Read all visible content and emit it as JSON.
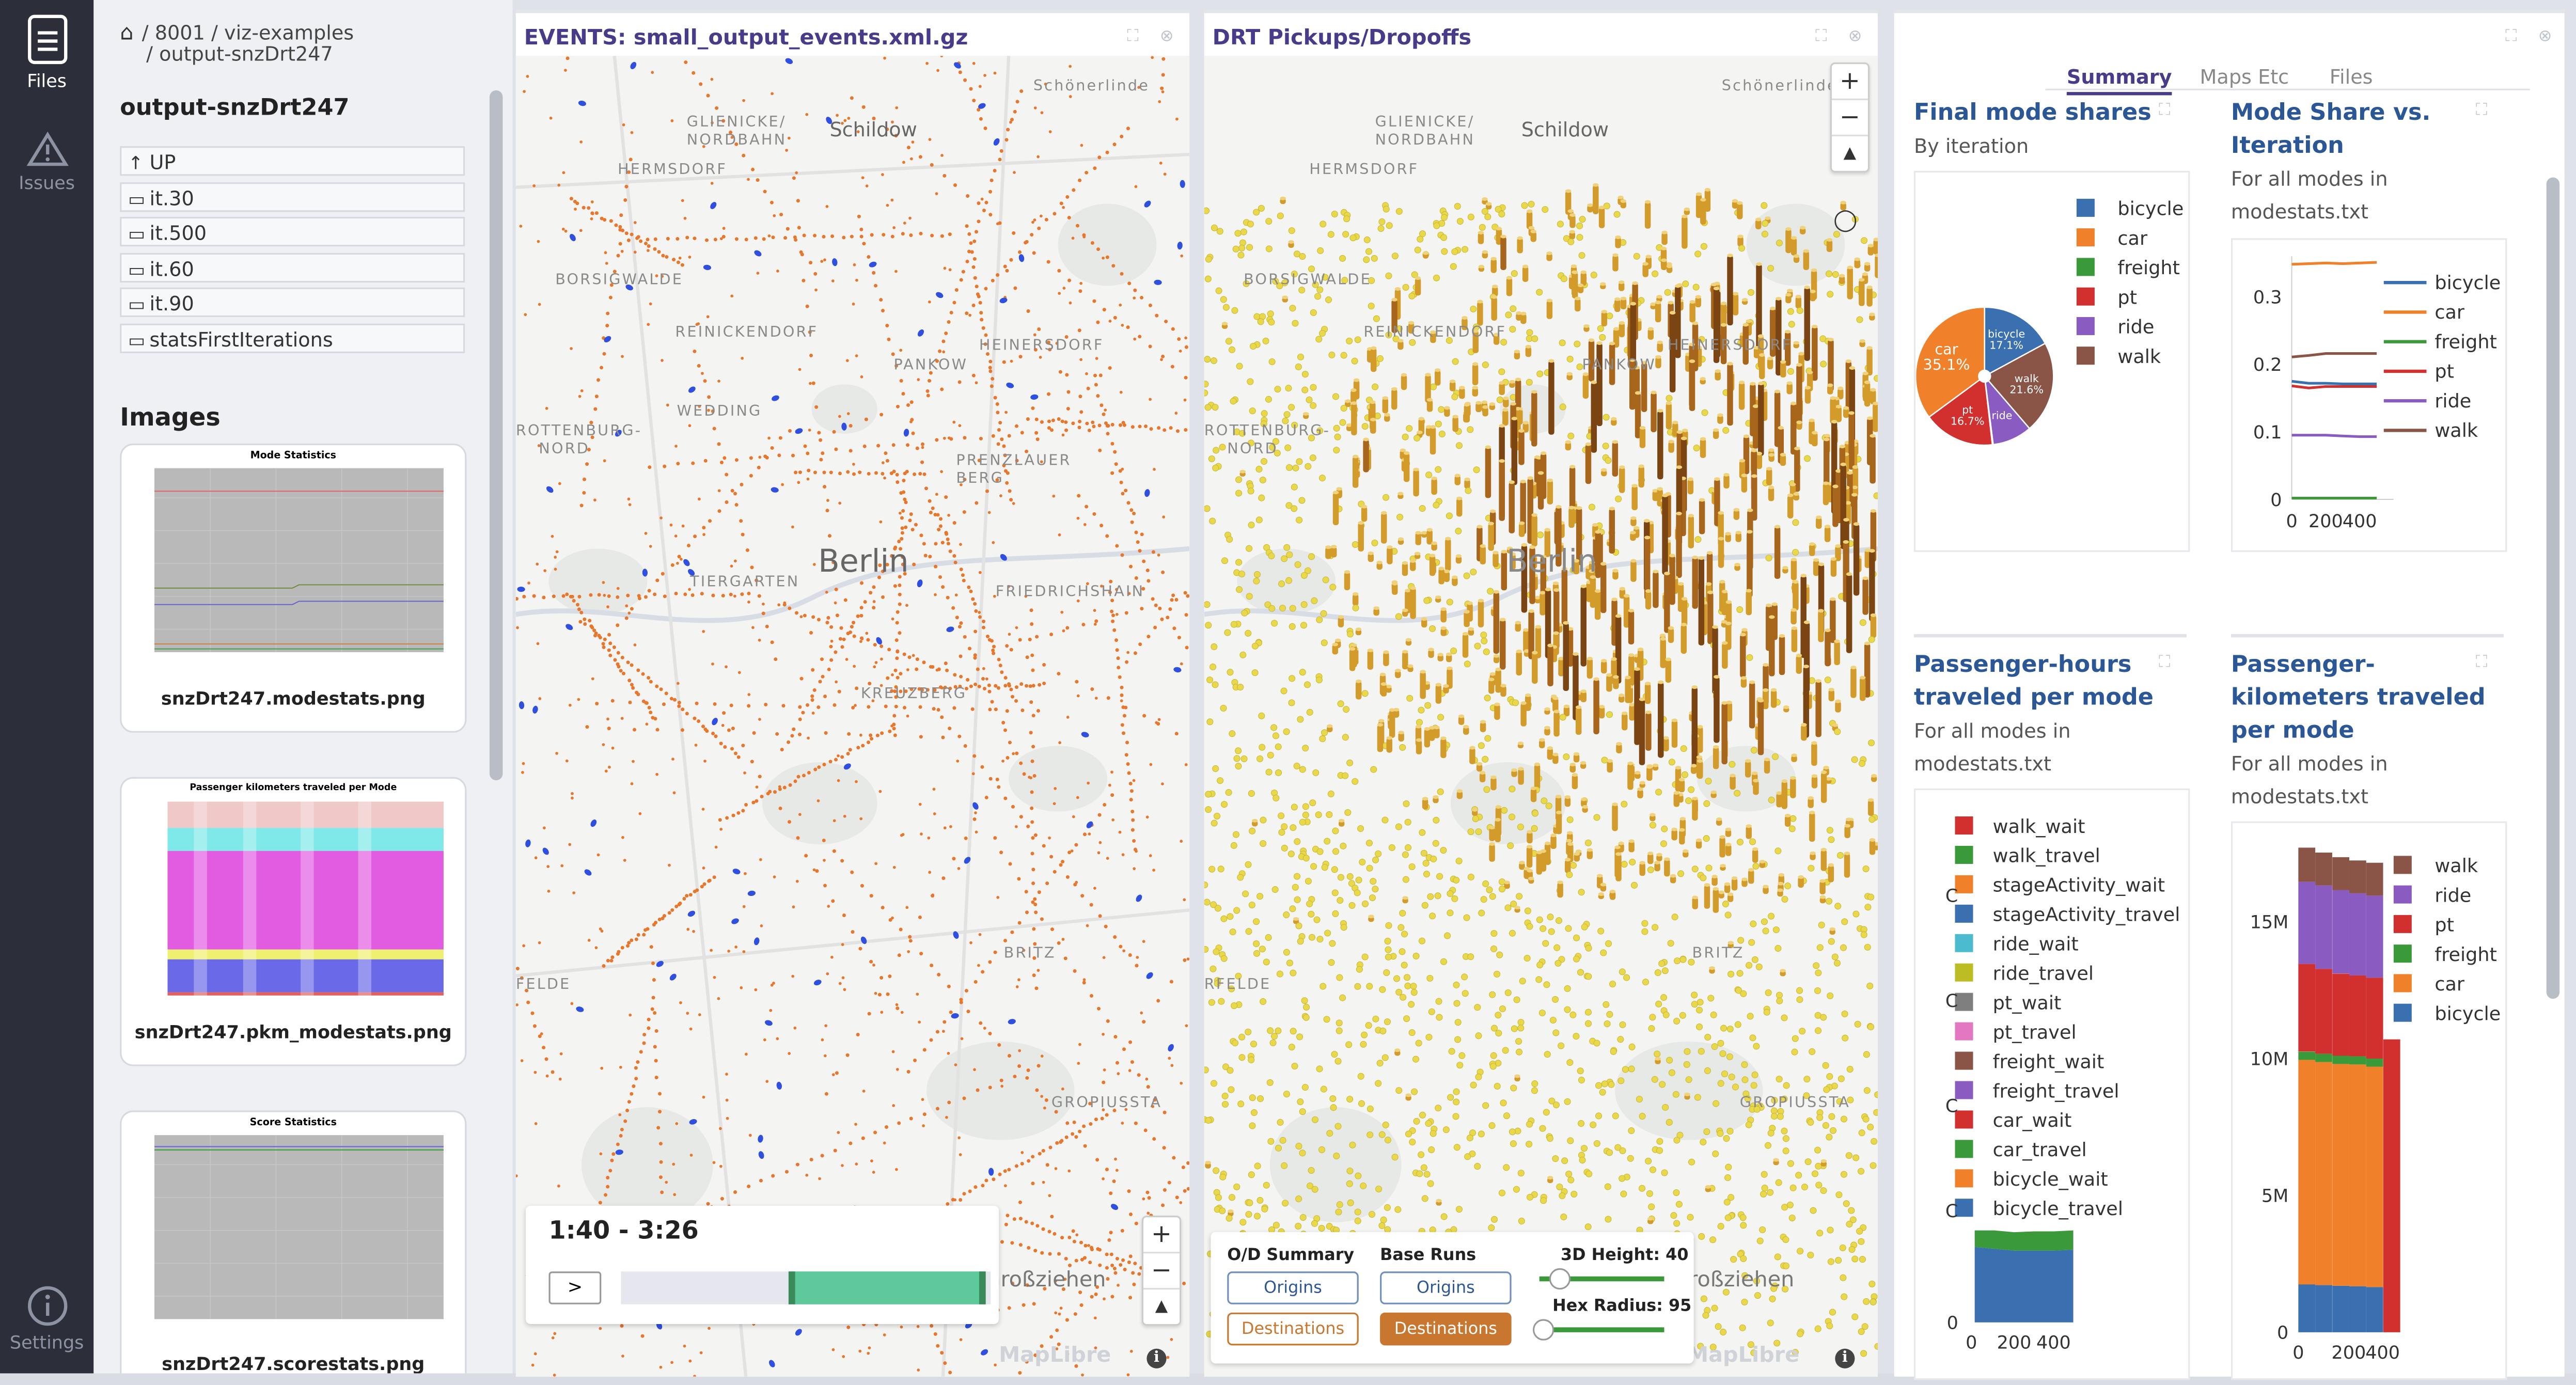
{
  "rail": {
    "files_label": "Files",
    "issues_label": "Issues",
    "settings_label": "Settings"
  },
  "browser": {
    "breadcrumb_line1": "/ 8001 / viz-examples",
    "breadcrumb_line2": "/ output-snzDrt247",
    "folder_title": "output-snzDrt247",
    "folders": [
      "UP",
      "it.30",
      "it.500",
      "it.60",
      "it.90",
      "statsFirstIterations"
    ],
    "images_heading": "Images",
    "images": [
      {
        "thumb_title": "Mode Statistics",
        "caption": "snzDrt247.modestats.png"
      },
      {
        "thumb_title": "Passenger kilometers traveled per Mode",
        "caption": "snzDrt247.pkm_modestats.png"
      },
      {
        "thumb_title": "Score Statistics",
        "caption": "snzDrt247.scorestats.png"
      }
    ]
  },
  "events_panel": {
    "title": "EVENTS: small_output_events.xml.gz",
    "time_range": "1:40 - 3:26",
    "play_label": ">",
    "maplibre": "MapLibre",
    "place_labels": [
      "Schönerlinde",
      "GLIENICKE/",
      "NORDBAHN",
      "Schildow",
      "HERMSDORF",
      "BORSIGWALDE",
      "REINICKENDORF",
      "PANKOW",
      "HEINERSDORF",
      "WEDDING",
      "ROTTENBURG-",
      "NORD",
      "PRENZLAUER",
      "BERG",
      "Berlin",
      "TIERGARTEN",
      "FRIEDRICHSHAIN",
      "KREUZBERG",
      "BRITZ",
      "FELDE",
      "GROPIUSSTA",
      "Großziehen"
    ]
  },
  "drt_panel": {
    "title": "DRT Pickups/Dropoffs",
    "od_summary_label": "O/D Summary",
    "base_runs_label": "Base Runs",
    "origins_label": "Origins",
    "destinations_label": "Destinations",
    "height_label": "3D Height: 40",
    "radius_label": "Hex Radius: 95",
    "maplibre": "MapLibre",
    "place_labels": [
      "Schönerlinde",
      "GLIENICKE/",
      "NORDBAHN",
      "Schildow",
      "HERMSDORF",
      "BORSIGWALDE",
      "REINICKENDORF",
      "PANKOW",
      "HEINERSDORF",
      "ROTTENBURG-",
      "NORD",
      "Berlin",
      "BRITZ",
      "RFELDE",
      "GROPIUSSTA",
      "Großziehen"
    ]
  },
  "dashboard": {
    "tabs": [
      "Summary",
      "Maps Etc",
      "Files"
    ],
    "cards": [
      {
        "title_line1": "Final mode shares",
        "subtitle": "By iteration"
      },
      {
        "title_line1": "Mode Share vs.",
        "title_line2": "Iteration",
        "subtitle_line1": "For all modes in",
        "subtitle_line2": "modestats.txt"
      },
      {
        "title_line1": "Passenger-hours",
        "title_line2": "traveled per mode",
        "subtitle_line1": "For all modes in",
        "subtitle_line2": "modestats.txt"
      },
      {
        "title_line1": "Passenger-",
        "title_line2": "kilometers traveled",
        "title_line3": "per mode",
        "subtitle_line1": "For all modes in",
        "subtitle_line2": "modestats.txt"
      }
    ]
  },
  "colors": {
    "bicycle": "#3a6fb0",
    "car": "#f0812a",
    "freight": "#3a9a3a",
    "pt": "#d22f2f",
    "ride": "#8a5cc2",
    "walk": "#8a5446",
    "accent": "#4a3a8a",
    "title_blue": "#2b5797",
    "green_bar": "#5ec99a"
  },
  "chart_data": [
    {
      "type": "pie",
      "categories": [
        "bicycle",
        "car",
        "freight",
        "pt",
        "ride",
        "walk"
      ],
      "values": [
        17.1,
        35.1,
        0.2,
        16.7,
        9.3,
        21.6
      ],
      "slice_labels": [
        "bicycle\n17.1%",
        "car\n35.1%",
        "",
        "pt\n16.7%",
        "ride",
        "walk\n21.6%"
      ],
      "legend": [
        "bicycle",
        "car",
        "freight",
        "pt",
        "ride",
        "walk"
      ]
    },
    {
      "type": "line",
      "x": [
        0,
        100,
        200,
        300,
        400,
        500
      ],
      "xticks": [
        "0",
        "200",
        "400"
      ],
      "yticks": [
        "0",
        "0.1",
        "0.2",
        "0.3"
      ],
      "ylim": [
        0,
        0.36
      ],
      "xlim": [
        0,
        600
      ],
      "series": [
        {
          "name": "bicycle",
          "values": [
            0.175,
            0.172,
            0.172,
            0.171,
            0.171,
            0.171
          ]
        },
        {
          "name": "car",
          "values": [
            0.348,
            0.349,
            0.35,
            0.349,
            0.35,
            0.351
          ]
        },
        {
          "name": "freight",
          "values": [
            0.002,
            0.002,
            0.002,
            0.002,
            0.002,
            0.002
          ]
        },
        {
          "name": "pt",
          "values": [
            0.168,
            0.165,
            0.167,
            0.167,
            0.167,
            0.167
          ]
        },
        {
          "name": "ride",
          "values": [
            0.095,
            0.095,
            0.095,
            0.094,
            0.093,
            0.093
          ]
        },
        {
          "name": "walk",
          "values": [
            0.211,
            0.213,
            0.216,
            0.216,
            0.216,
            0.216
          ]
        }
      ]
    },
    {
      "type": "area",
      "x": [
        0,
        100,
        200,
        300,
        400,
        500
      ],
      "xticks": [
        "0",
        "200",
        "400"
      ],
      "yticks": [
        "0",
        "C",
        "C",
        "C",
        "C"
      ],
      "legend": [
        "walk_wait",
        "walk_travel",
        "stageActivity_wait",
        "stageActivity_travel",
        "ride_wait",
        "ride_travel",
        "pt_wait",
        "pt_travel",
        "freight_wait",
        "freight_travel",
        "car_wait",
        "car_travel",
        "bicycle_wait",
        "bicycle_travel"
      ],
      "legend_colors": [
        "#d22f2f",
        "#3a9a3a",
        "#f0812a",
        "#3a6fb0",
        "#4bbcd0",
        "#bcbd22",
        "#7f7f7f",
        "#e377c2",
        "#8a5446",
        "#8a5cc2",
        "#d22f2f",
        "#3a9a3a",
        "#f0812a",
        "#3a6fb0"
      ],
      "series": [
        {
          "name": "bicycle_travel",
          "values": [
            0.82,
            0.8,
            0.78,
            0.78,
            0.78,
            0.79
          ]
        },
        {
          "name": "car_travel",
          "values": [
            0.18,
            0.2,
            0.2,
            0.21,
            0.21,
            0.21
          ]
        }
      ]
    },
    {
      "type": "bar",
      "stacked": true,
      "x": [
        0,
        100,
        200,
        300,
        400,
        500
      ],
      "xticks": [
        "0",
        "200",
        "400"
      ],
      "yticks": [
        "0",
        "5M",
        "10M",
        "15M"
      ],
      "ylim": [
        0,
        18000000
      ],
      "legend": [
        "walk",
        "ride",
        "pt",
        "freight",
        "car",
        "bicycle"
      ],
      "series": [
        {
          "name": "bicycle",
          "values": [
            1750000,
            1720000,
            1700000,
            1680000,
            1650000,
            0
          ]
        },
        {
          "name": "car",
          "values": [
            8200000,
            8150000,
            8100000,
            8100000,
            8050000,
            0
          ]
        },
        {
          "name": "freight",
          "values": [
            300000,
            300000,
            300000,
            300000,
            300000,
            0
          ]
        },
        {
          "name": "pt",
          "values": [
            3200000,
            3100000,
            3000000,
            2950000,
            2950000,
            10700000
          ]
        },
        {
          "name": "ride",
          "values": [
            3000000,
            3050000,
            3050000,
            3000000,
            3000000,
            0
          ]
        },
        {
          "name": "walk",
          "values": [
            1250000,
            1200000,
            1200000,
            1200000,
            1200000,
            0
          ]
        }
      ]
    }
  ]
}
